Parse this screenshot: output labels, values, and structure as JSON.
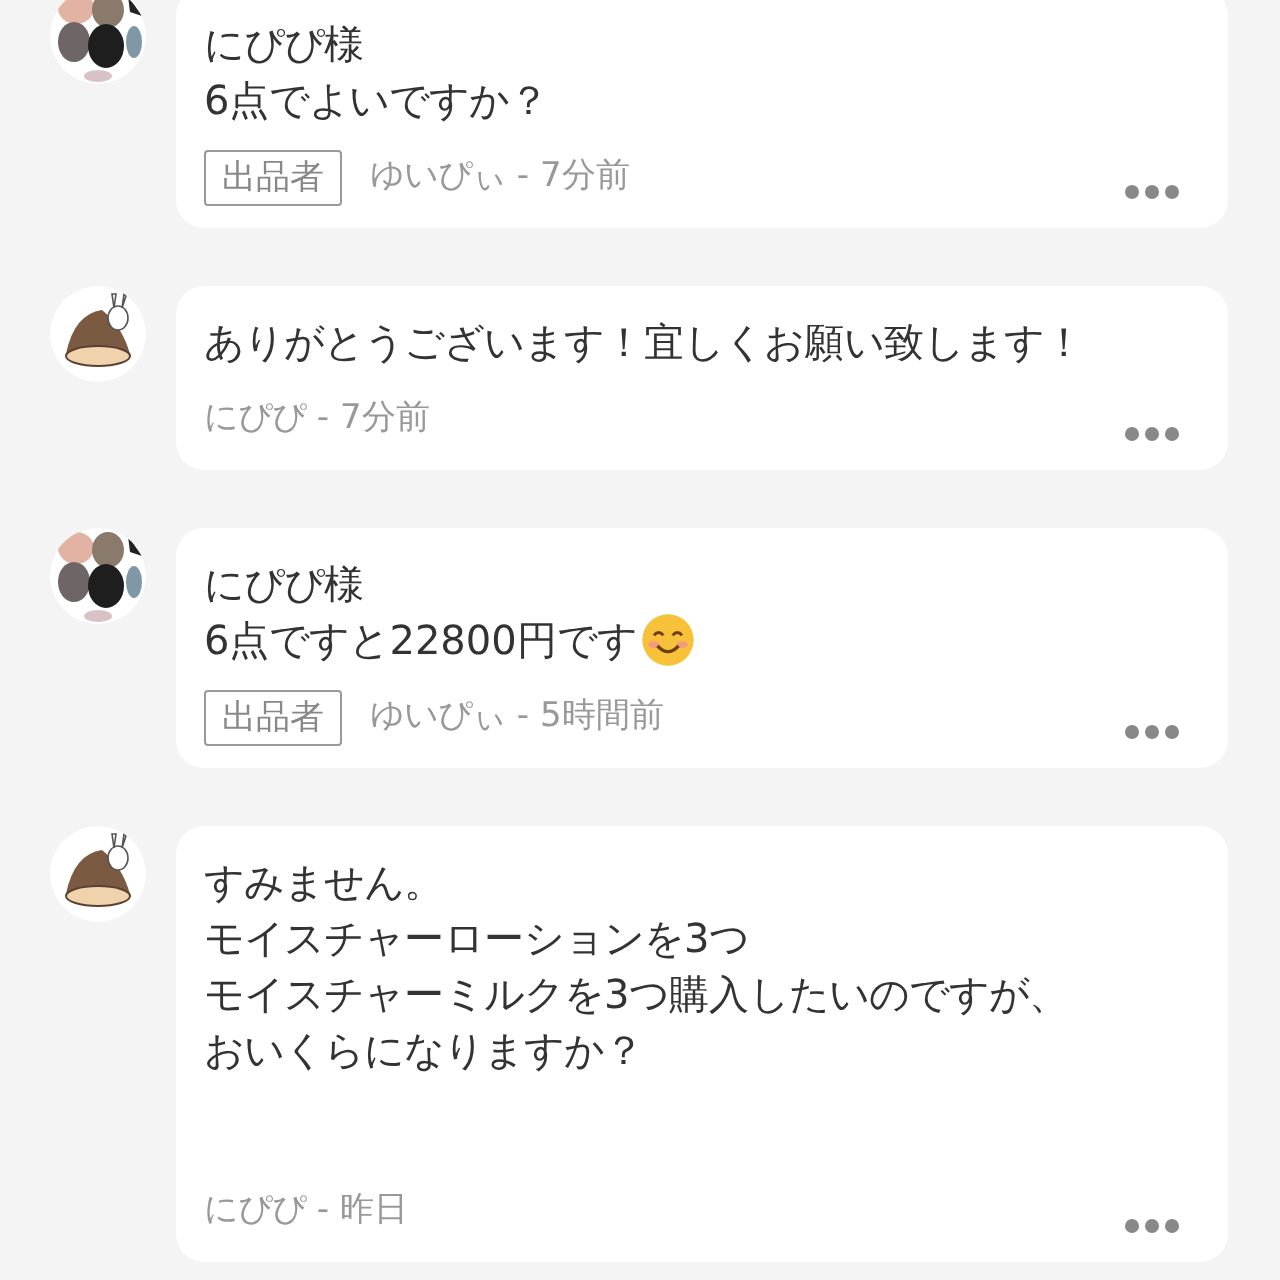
{
  "comments": [
    {
      "avatar": {
        "kind": "picture"
      },
      "lines": [
        "にぴぴ様",
        "6点でよいですか？"
      ],
      "badge": "出品者",
      "author": "ゆいぴぃ",
      "time": "- 7分前"
    },
    {
      "avatar": {
        "kind": "picture"
      },
      "lines": [
        "ありがとうございます！宜しくお願い致します！"
      ],
      "author": "にぴぴ",
      "time": "- 7分前"
    },
    {
      "avatar": {
        "kind": "picture"
      },
      "lines": [
        "にぴぴ様",
        "6点ですと22800円です"
      ],
      "smiley": true,
      "badge": "出品者",
      "author": "ゆいぴぃ",
      "time": "- 5時間前"
    },
    {
      "avatar": {
        "kind": "picture"
      },
      "lines": [
        "すみません。",
        "モイスチャーローションを3つ",
        "モイスチャーミルクを3つ購入したいのですが、",
        "おいくらになりますか？"
      ],
      "trailing_blank_line": true,
      "author": "にぴぴ",
      "time": "- 昨日"
    }
  ]
}
